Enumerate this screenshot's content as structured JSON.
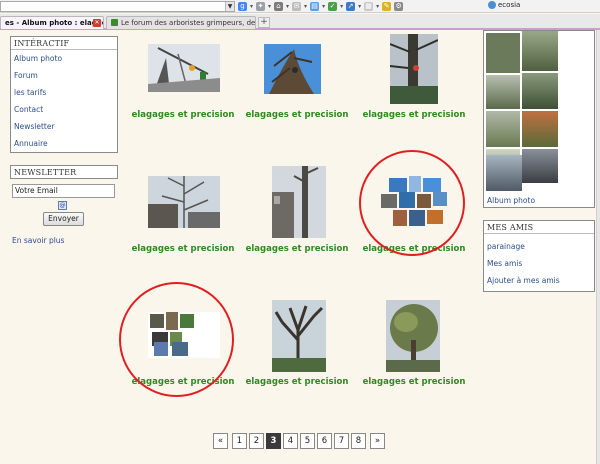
{
  "browser": {
    "ecosia_label": "ecosia",
    "tabs": [
      {
        "label": "es - Album photo : elague..."
      },
      {
        "label": "Le forum des arboristes grimpeurs, des..."
      }
    ],
    "new_tab": "+"
  },
  "sidebar": {
    "interactif_title": "INTÉRACTIF",
    "interactif_items": [
      "Album photo",
      "Forum",
      "les tarifs",
      "Contact",
      "Newsletter",
      "Annuaire"
    ],
    "newsletter_title": "NEWSLETTER",
    "email_value": "Votre Email",
    "send_label": "Envoyer",
    "more_label": "En savoir plus"
  },
  "album": {
    "items": [
      {
        "label": "elagages et precision",
        "icon": "crane-climber-photo"
      },
      {
        "label": "elagages et precision",
        "icon": "sky-climber-photo"
      },
      {
        "label": "elagages et precision",
        "icon": "trunk-climber-photo"
      },
      {
        "label": "elagages et precision",
        "icon": "house-tree-photo"
      },
      {
        "label": "elagages et precision",
        "icon": "tall-trunk-photo"
      },
      {
        "label": "elagages et precision",
        "icon": "collage-photo"
      },
      {
        "label": "elagages et precision",
        "icon": "small-collage-photo"
      },
      {
        "label": "elagages et precision",
        "icon": "bare-tree-photo"
      },
      {
        "label": "elagages et precision",
        "icon": "green-tree-photo"
      }
    ]
  },
  "pagination": {
    "prev": "«",
    "pages": [
      "1",
      "2",
      "3",
      "4",
      "5",
      "6",
      "7",
      "8"
    ],
    "current": "3",
    "next": "»"
  },
  "right": {
    "album_link": "Album photo",
    "friends_title": "MES AMIS",
    "friends_items": [
      "parainage",
      "Mes amis",
      "Ajouter à mes amis"
    ]
  },
  "colors": {
    "label_green": "#2f8a1f",
    "link_blue": "#2c4f8c",
    "highlight_red": "#e02020",
    "page_bg": "#fbf6ec"
  }
}
